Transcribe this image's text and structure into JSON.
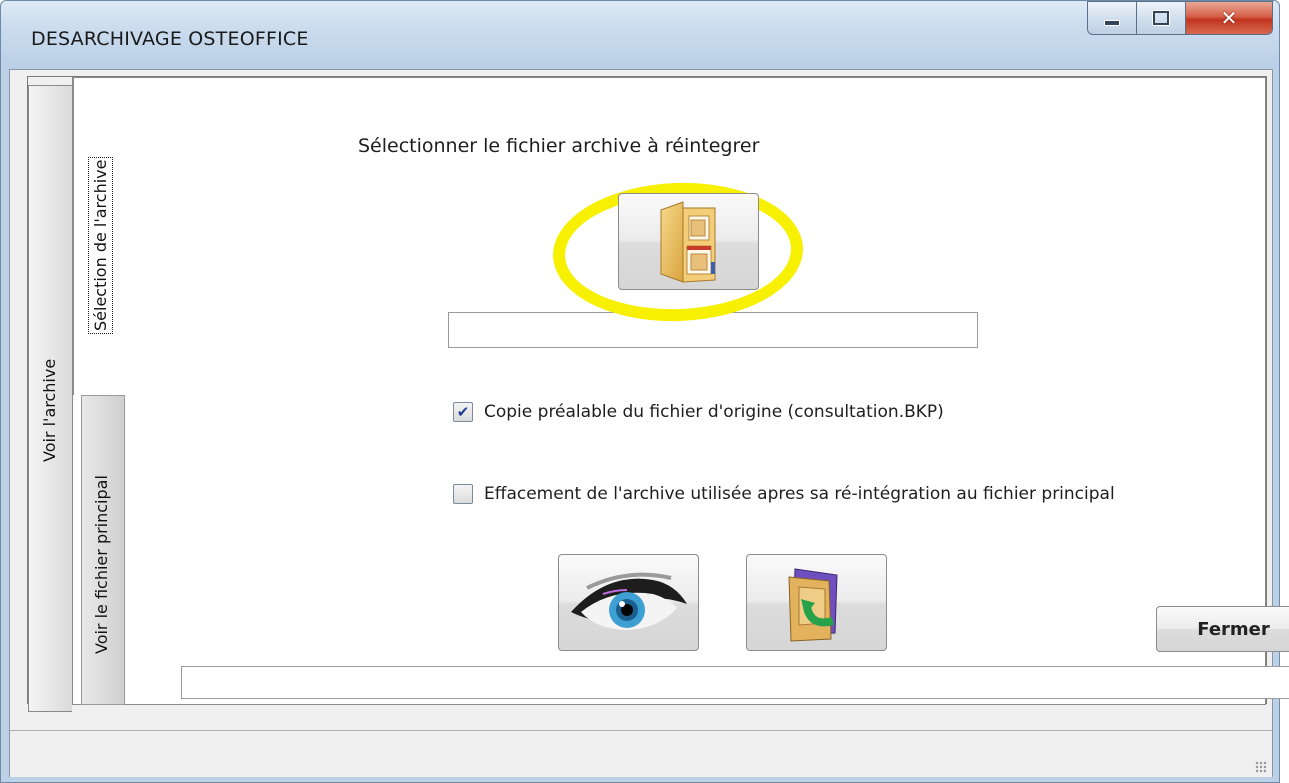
{
  "window": {
    "title": "DESARCHIVAGE OSTEOFFICE",
    "controls": {
      "minimize": "minimize-icon",
      "maximize": "maximize-icon",
      "close": "close-icon"
    }
  },
  "tabs": {
    "outer": [
      {
        "label": "Voir l'archive"
      }
    ],
    "inner": [
      {
        "label": "Sélection de l'archive",
        "active": true
      },
      {
        "label": "Voir le fichier principal",
        "active": false
      }
    ]
  },
  "main": {
    "heading": "Sélectionner le fichier archive à réintegrer",
    "browse_icon": "folder-open-icon",
    "path_value": "",
    "options": [
      {
        "label": "Copie préalable du fichier d'origine  (consultation.BKP)",
        "checked": true
      },
      {
        "label": "Effacement de l'archive utilisée apres sa ré-intégration au fichier principal",
        "checked": false
      }
    ],
    "view_icon": "eye-icon",
    "restore_icon": "folder-restore-icon",
    "close_label": "Fermer",
    "status_text": ""
  },
  "colors": {
    "highlight": "#f7f000",
    "titlebar": "#c7d8eb",
    "close_button": "#c2341e"
  }
}
